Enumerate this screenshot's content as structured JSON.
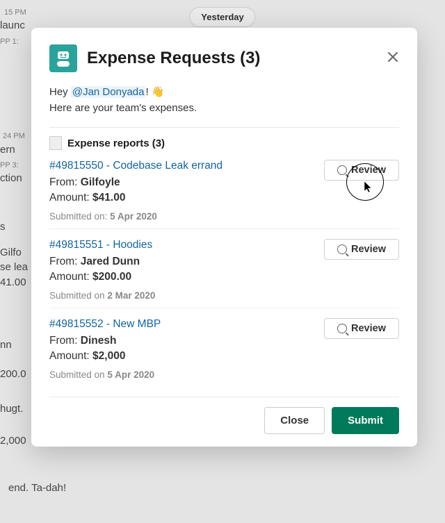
{
  "background": {
    "pill": "Yesterday",
    "t1": "15 PM",
    "t2": "launc",
    "t3": "PP  1:",
    "t4": "24 PM",
    "t5": "ern",
    "t6": "PP  3:",
    "t7": "ction",
    "t8": "s",
    "t9": "Gilfo",
    "t10": "se lea",
    "t11": "41.00",
    "t12": "nn",
    "t13": "200.0",
    "t14": "hugt.",
    "t15": "2,000",
    "t16": "end. Ta-dah!"
  },
  "modal": {
    "title": "Expense Requests (3)",
    "greeting_prefix": "Hey ",
    "mention": "@Jan Donyada",
    "greeting_suffix": "! 👋",
    "greeting_line2": "Here are your team's expenses.",
    "section_header": "Expense reports (3)",
    "close_label": "Close",
    "submit_label": "Submit",
    "review_label": "Review"
  },
  "reports": [
    {
      "title": "#49815550 - Codebase Leak errand",
      "from_label": "From: ",
      "from": "Gilfoyle",
      "amount_label": "Amount: ",
      "amount": "$41.00",
      "submitted_prefix": "Submitted on: ",
      "submitted_date": "5 Apr 2020"
    },
    {
      "title": "#49815551 - Hoodies",
      "from_label": "From: ",
      "from": "Jared Dunn",
      "amount_label": "Amount: ",
      "amount": "$200.00",
      "submitted_prefix": "Submitted on ",
      "submitted_date": "2 Mar 2020"
    },
    {
      "title": "#49815552 - New MBP",
      "from_label": "From: ",
      "from": "Dinesh",
      "amount_label": "Amount: ",
      "amount": "$2,000",
      "submitted_prefix": "Submitted on ",
      "submitted_date": "5 Apr 2020"
    }
  ]
}
